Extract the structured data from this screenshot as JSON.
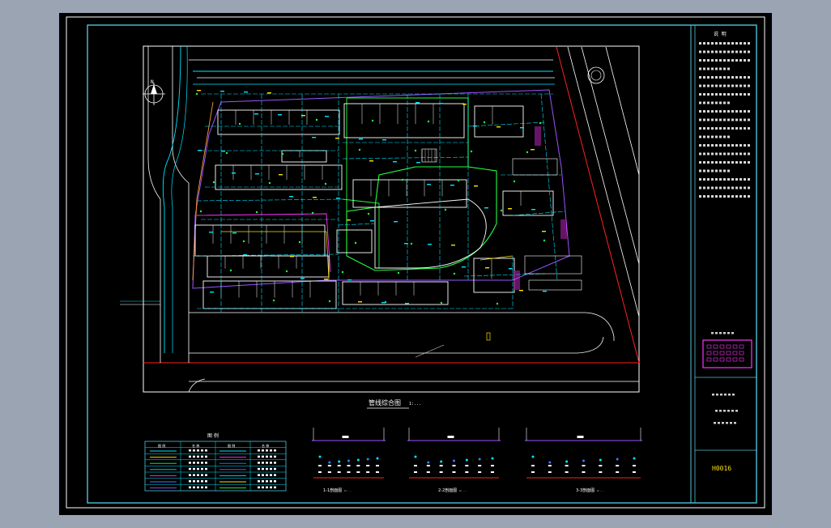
{
  "app": {
    "title": "",
    "background_color": "#9aa4b3",
    "canvas_color": "#000000"
  },
  "drawing": {
    "main_title": "管线综合图",
    "main_scale": "1:...",
    "sheet_code": "H0016",
    "legend_title": "图 例",
    "legend_headers": [
      "图 例",
      "名 称",
      "图 例",
      "名 称"
    ],
    "section_1_label": "1-1剖面图",
    "section_2_label": "2-2剖面图",
    "section_3_label": "3-3剖面图",
    "section_scale": "1:...",
    "north_label": "N",
    "notes_heading": "说 明",
    "colors": {
      "frame": "#4fc3d9",
      "white_lines": "#ffffff",
      "cyan": "#00e5ff",
      "green": "#22ff44",
      "yellow": "#ffe000",
      "magenta": "#ff33ff",
      "red": "#ff2020",
      "purple": "#9a55ff",
      "blue": "#3a7bff"
    }
  }
}
